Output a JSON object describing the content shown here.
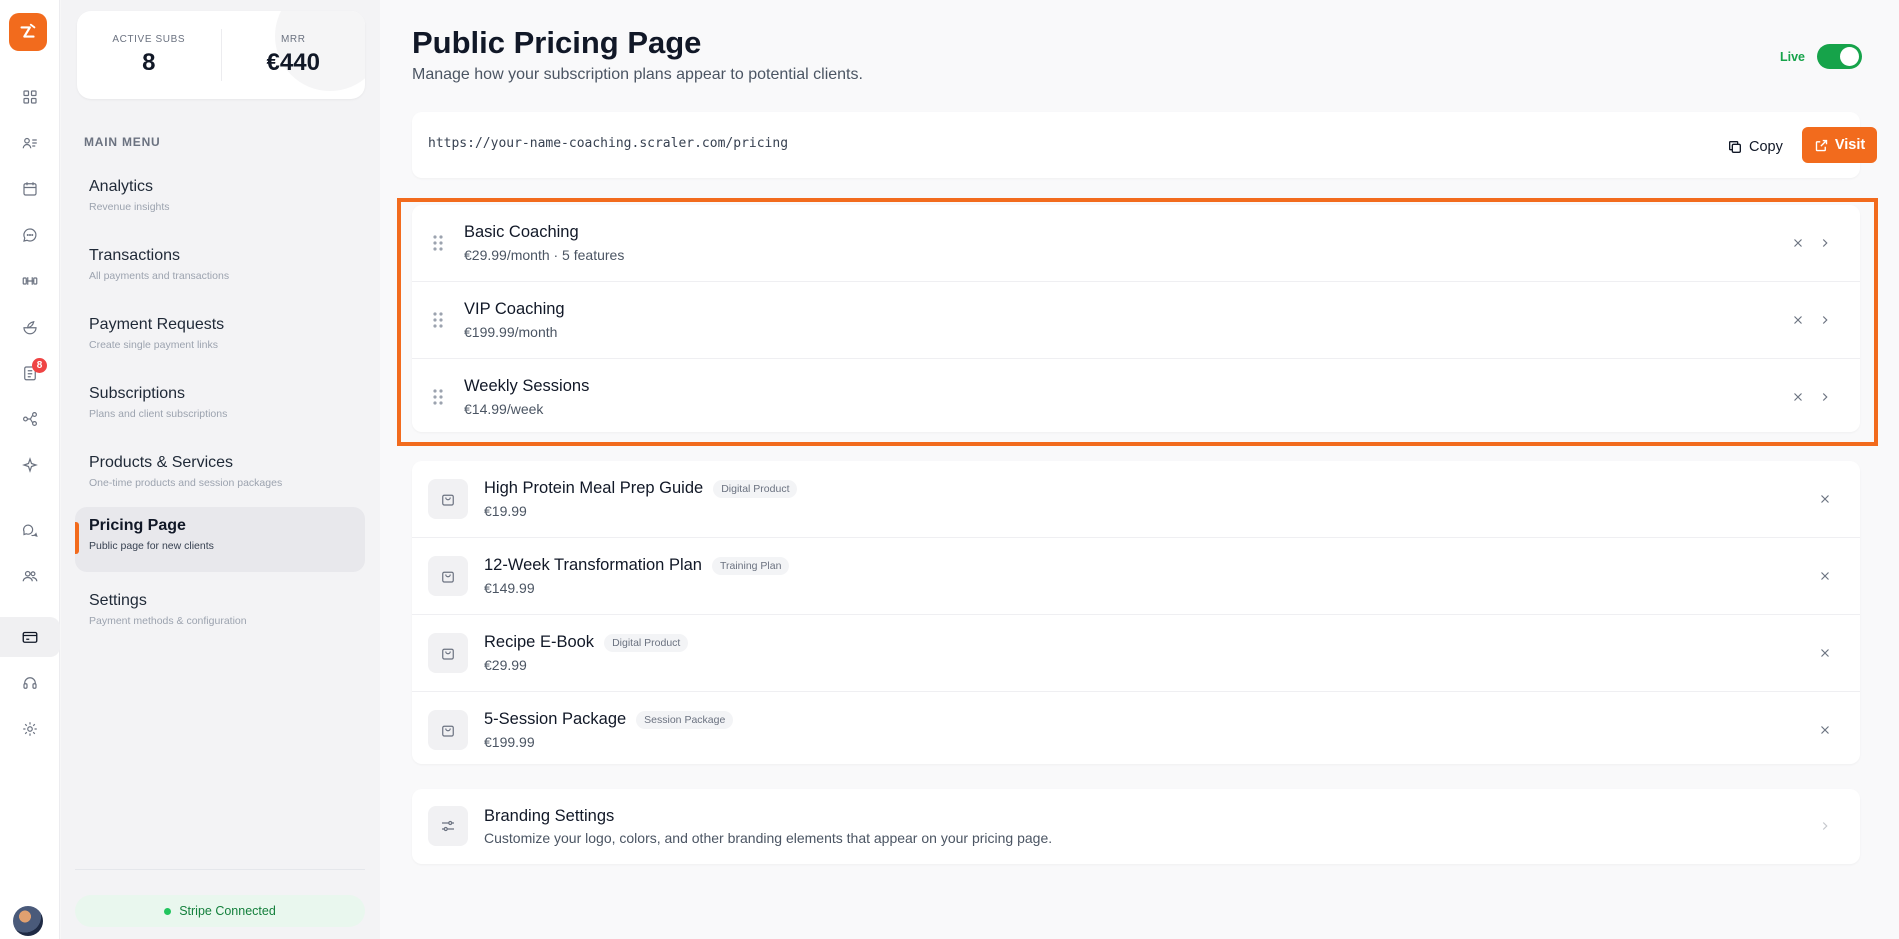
{
  "stats": {
    "active_subs_label": "ACTIVE SUBS",
    "active_subs_value": "8",
    "mrr_label": "MRR",
    "mrr_value": "€440"
  },
  "rail": {
    "icons": [
      "dashboard-icon",
      "clients-icon",
      "calendar-icon",
      "messages-icon",
      "workouts-icon",
      "nutrition-icon",
      "tasks-icon",
      "automations-icon",
      "ai-icon",
      "community-icon",
      "team-icon",
      "payments-icon",
      "support-icon",
      "settings-icon"
    ],
    "tasks_badge": "8"
  },
  "sidebar": {
    "menu_title": "MAIN MENU",
    "items": [
      {
        "label": "Analytics",
        "sub": "Revenue insights"
      },
      {
        "label": "Transactions",
        "sub": "All payments and transactions"
      },
      {
        "label": "Payment Requests",
        "sub": "Create single payment links"
      },
      {
        "label": "Subscriptions",
        "sub": "Plans and client subscriptions"
      },
      {
        "label": "Products & Services",
        "sub": "One-time products and session packages"
      },
      {
        "label": "Pricing Page",
        "sub": "Public page for new clients"
      },
      {
        "label": "Settings",
        "sub": "Payment methods & configuration"
      }
    ],
    "active_item": "Pricing Page",
    "stripe_status": "Stripe Connected"
  },
  "header": {
    "title": "Public Pricing Page",
    "subtitle": "Manage how your subscription plans appear to potential clients.",
    "live_label": "Live"
  },
  "url_bar": {
    "url": "https://your-name-coaching.scraler.com/pricing",
    "copy_label": "Copy",
    "visit_label": "Visit"
  },
  "plans": [
    {
      "name": "Basic Coaching",
      "meta": "€29.99/month  ·  5 features"
    },
    {
      "name": "VIP Coaching",
      "meta": "€199.99/month"
    },
    {
      "name": "Weekly Sessions",
      "meta": "€14.99/week"
    }
  ],
  "products": [
    {
      "name": "High Protein Meal Prep Guide",
      "tag": "Digital Product",
      "price": "€19.99"
    },
    {
      "name": "12-Week Transformation Plan",
      "tag": "Training Plan",
      "price": "€149.99"
    },
    {
      "name": "Recipe E-Book",
      "tag": "Digital Product",
      "price": "€29.99"
    },
    {
      "name": "5-Session Package",
      "tag": "Session Package",
      "price": "€199.99"
    }
  ],
  "branding": {
    "title": "Branding Settings",
    "subtitle": "Customize your logo, colors, and other branding elements that appear on your pricing page."
  },
  "colors": {
    "accent": "#f26b1d",
    "live_green": "#16a34a"
  }
}
